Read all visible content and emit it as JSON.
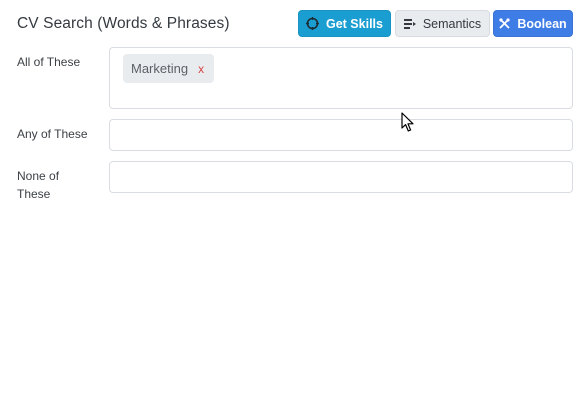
{
  "header": {
    "title": "CV Search (Words & Phrases)"
  },
  "toolbar": {
    "get_skills_label": "Get Skills",
    "semantics_label": "Semantics",
    "boolean_label": "Boolean"
  },
  "fields": {
    "all_label": "All of These",
    "any_label": "Any of These",
    "none_label": "None of These",
    "all_tags": [
      {
        "label": "Marketing",
        "remove": "x"
      }
    ]
  },
  "colors": {
    "get_skills_bg": "#1a9ed1",
    "semantics_bg": "#e9ecef",
    "boolean_bg": "#3f7de6",
    "tag_remove": "#d64545"
  }
}
